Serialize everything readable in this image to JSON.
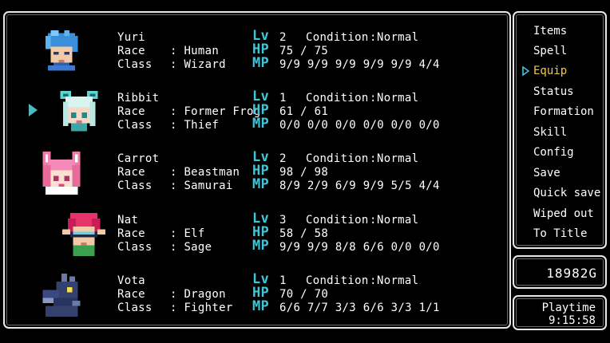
{
  "labels": {
    "race": "Race",
    "class": "Class",
    "lv": "Lv",
    "hp": "HP",
    "mp": "MP",
    "condition": "Condition",
    "colon": ":"
  },
  "party": [
    {
      "name": "Yuri",
      "race": ": Human",
      "class": ": Wizard",
      "level": "2",
      "condition": "Normal",
      "hp": "75 / 75",
      "mp": "9/9 9/9 9/9 9/9 9/9 4/4",
      "selected": false,
      "portrait": "yuri-portrait-blue-hair"
    },
    {
      "name": "Ribbit",
      "race": ": Former Frog",
      "class": ": Thief",
      "level": "1",
      "condition": "Normal",
      "hp": "61 / 61",
      "mp": "0/0 0/0 0/0 0/0 0/0 0/0",
      "selected": true,
      "portrait": "ribbit-portrait-teal-hair"
    },
    {
      "name": "Carrot",
      "race": ": Beastman",
      "class": ": Samurai",
      "level": "2",
      "condition": "Normal",
      "hp": "98 / 98",
      "mp": "8/9 2/9 6/9 9/9 5/5 4/4",
      "selected": false,
      "portrait": "carrot-portrait-pink-cat"
    },
    {
      "name": "Nat",
      "race": ": Elf",
      "class": ": Sage",
      "level": "3",
      "condition": "Normal",
      "hp": "58 / 58",
      "mp": "9/9 9/9 8/8 6/6 0/0 0/0",
      "selected": false,
      "portrait": "nat-portrait-red-hair-visor"
    },
    {
      "name": "Vota",
      "race": ": Dragon",
      "class": ": Fighter",
      "level": "1",
      "condition": "Normal",
      "hp": "70 / 70",
      "mp": "6/6 7/7 3/3 6/6 3/3 1/1",
      "selected": false,
      "portrait": "vota-portrait-dragon"
    }
  ],
  "menu": {
    "items": [
      "Items",
      "Spell",
      "Equip",
      "Status",
      "Formation",
      "Skill",
      "Config",
      "Save",
      "Quick save",
      "Wiped out",
      "To Title"
    ],
    "active": "Equip"
  },
  "gold": "18982G",
  "playtime": {
    "label": "Playtime",
    "value": "9:15:58"
  },
  "colors": {
    "accent": "#41c6d8",
    "active_menu": "#f3c64a",
    "border": "#e8e8e8",
    "background": "#000000"
  }
}
